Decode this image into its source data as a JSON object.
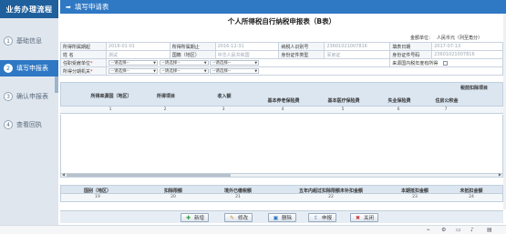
{
  "sidebar": {
    "title": "业务办理流程",
    "items": [
      {
        "num": "1",
        "label": "基础信息"
      },
      {
        "num": "2",
        "label": "填写申报表"
      },
      {
        "num": "3",
        "label": "确认申报表"
      },
      {
        "num": "4",
        "label": "查看回执"
      }
    ]
  },
  "header": {
    "title": "填写申请表"
  },
  "form": {
    "title": "个人所得税自行纳税申报表（B表）",
    "unit_label": "金额单位：",
    "unit_value": "人民币元（列至角分）",
    "rows": [
      [
        {
          "label": "所得所属期起",
          "value": "2016-01-01"
        },
        {
          "label": "所得所属期止",
          "value": "2016-12-31"
        },
        {
          "label": "纳税人识别号",
          "value": "23601021007816"
        },
        {
          "label": "填表日期",
          "value": "2017-07-13"
        }
      ],
      [
        {
          "label": "姓  名",
          "value": "测试"
        },
        {
          "label": "国籍（地区）",
          "value": "中华人民共和国"
        },
        {
          "label": "身份证件类型",
          "value": "军官证"
        },
        {
          "label": "身份证件号码",
          "value": "23601021007816"
        }
      ]
    ],
    "row3": {
      "label": "任职受雇单位",
      "select1": "--请选择--",
      "select2": "--请选择--",
      "select3": "--请选择--",
      "check_label": "来源国内税年度有所得"
    },
    "row4": {
      "label": "所得分期机关",
      "select1": "--请选择--",
      "select2": "--请选择--",
      "select3": "--请选择--"
    }
  },
  "income_table": {
    "group_header": "税前扣除项目",
    "headers": [
      "所得来源国（地区）",
      "所得项目",
      "收入额",
      "基本养老保险费",
      "基本医疗保险费",
      "失业保险费",
      "住房公积金"
    ],
    "col_numbers": [
      "1",
      "2",
      "3",
      "4",
      "5",
      "6",
      "7"
    ]
  },
  "summary_table": {
    "headers": [
      "国别（地区）",
      "扣除限额",
      "境外已缴税额",
      "五年内超过扣除限额未补扣金额",
      "本期抵扣金额",
      "未抵扣金额"
    ],
    "col_numbers": [
      "19",
      "20",
      "21",
      "22",
      "23",
      "24"
    ]
  },
  "toolbar": {
    "add": "新增",
    "edit": "修改",
    "delete": "删除",
    "declare": "申报",
    "close": "关闭"
  },
  "colors": {
    "primary": "#2f78c4",
    "sidebar_title": "#1f5f9c",
    "table_header": "#dbe6f1"
  }
}
